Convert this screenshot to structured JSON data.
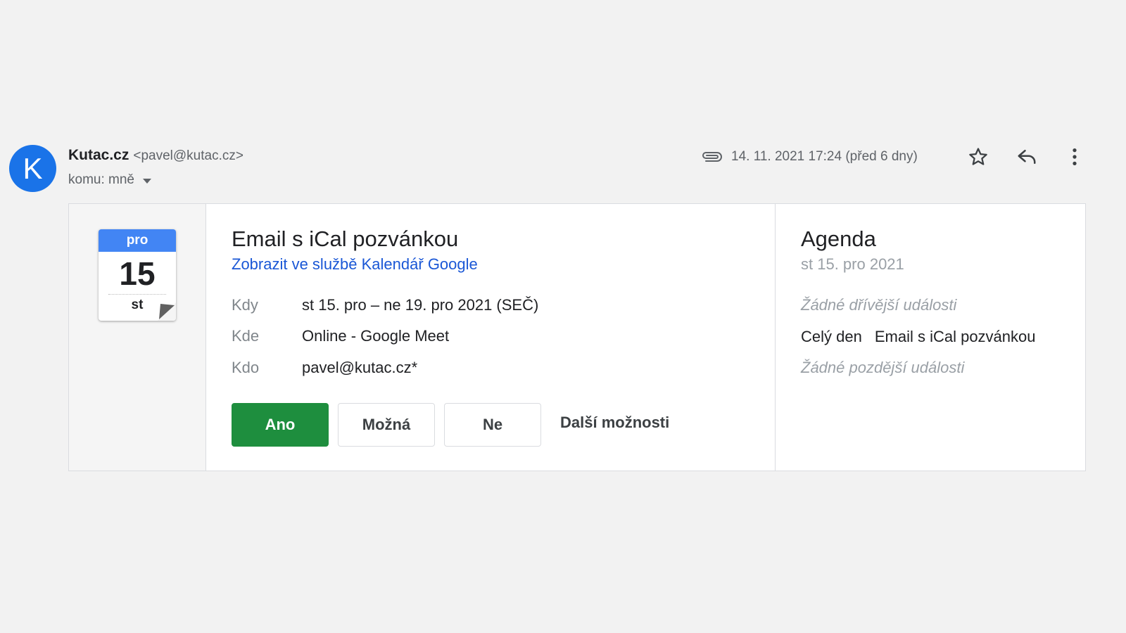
{
  "sender": {
    "avatar_letter": "K",
    "name": "Kutac.cz",
    "email": "<pavel@kutac.cz>",
    "recipients": "komu: mně"
  },
  "meta": {
    "date": "14. 11. 2021 17:24 (před 6 dny)",
    "icons": [
      "paperclip-icon",
      "star-icon",
      "reply-icon",
      "more-vert-icon"
    ]
  },
  "calendar_icon": {
    "month": "pro",
    "day": "15",
    "weekday": "st"
  },
  "event": {
    "title": "Email s iCal pozvánkou",
    "link": "Zobrazit ve službě Kalendář Google",
    "details": [
      {
        "label": "Kdy",
        "value": "st 15. pro – ne 19. pro 2021 (SEČ)"
      },
      {
        "label": "Kde",
        "value": "Online - Google Meet"
      },
      {
        "label": "Kdo",
        "value": "pavel@kutac.cz*"
      }
    ],
    "rsvp": {
      "yes": "Ano",
      "maybe": "Možná",
      "no": "Ne",
      "more": "Další možnosti"
    }
  },
  "agenda": {
    "title": "Agenda",
    "date": "st 15. pro 2021",
    "no_earlier": "Žádné dřívější události",
    "event_time": "Celý den",
    "event_title": "Email s iCal pozvánkou",
    "no_later": "Žádné pozdější události"
  },
  "colors": {
    "avatar": "#1a73e8",
    "calendar_month": "#4285f4",
    "yes_button": "#1e8e3e",
    "link": "#1a57d6"
  }
}
